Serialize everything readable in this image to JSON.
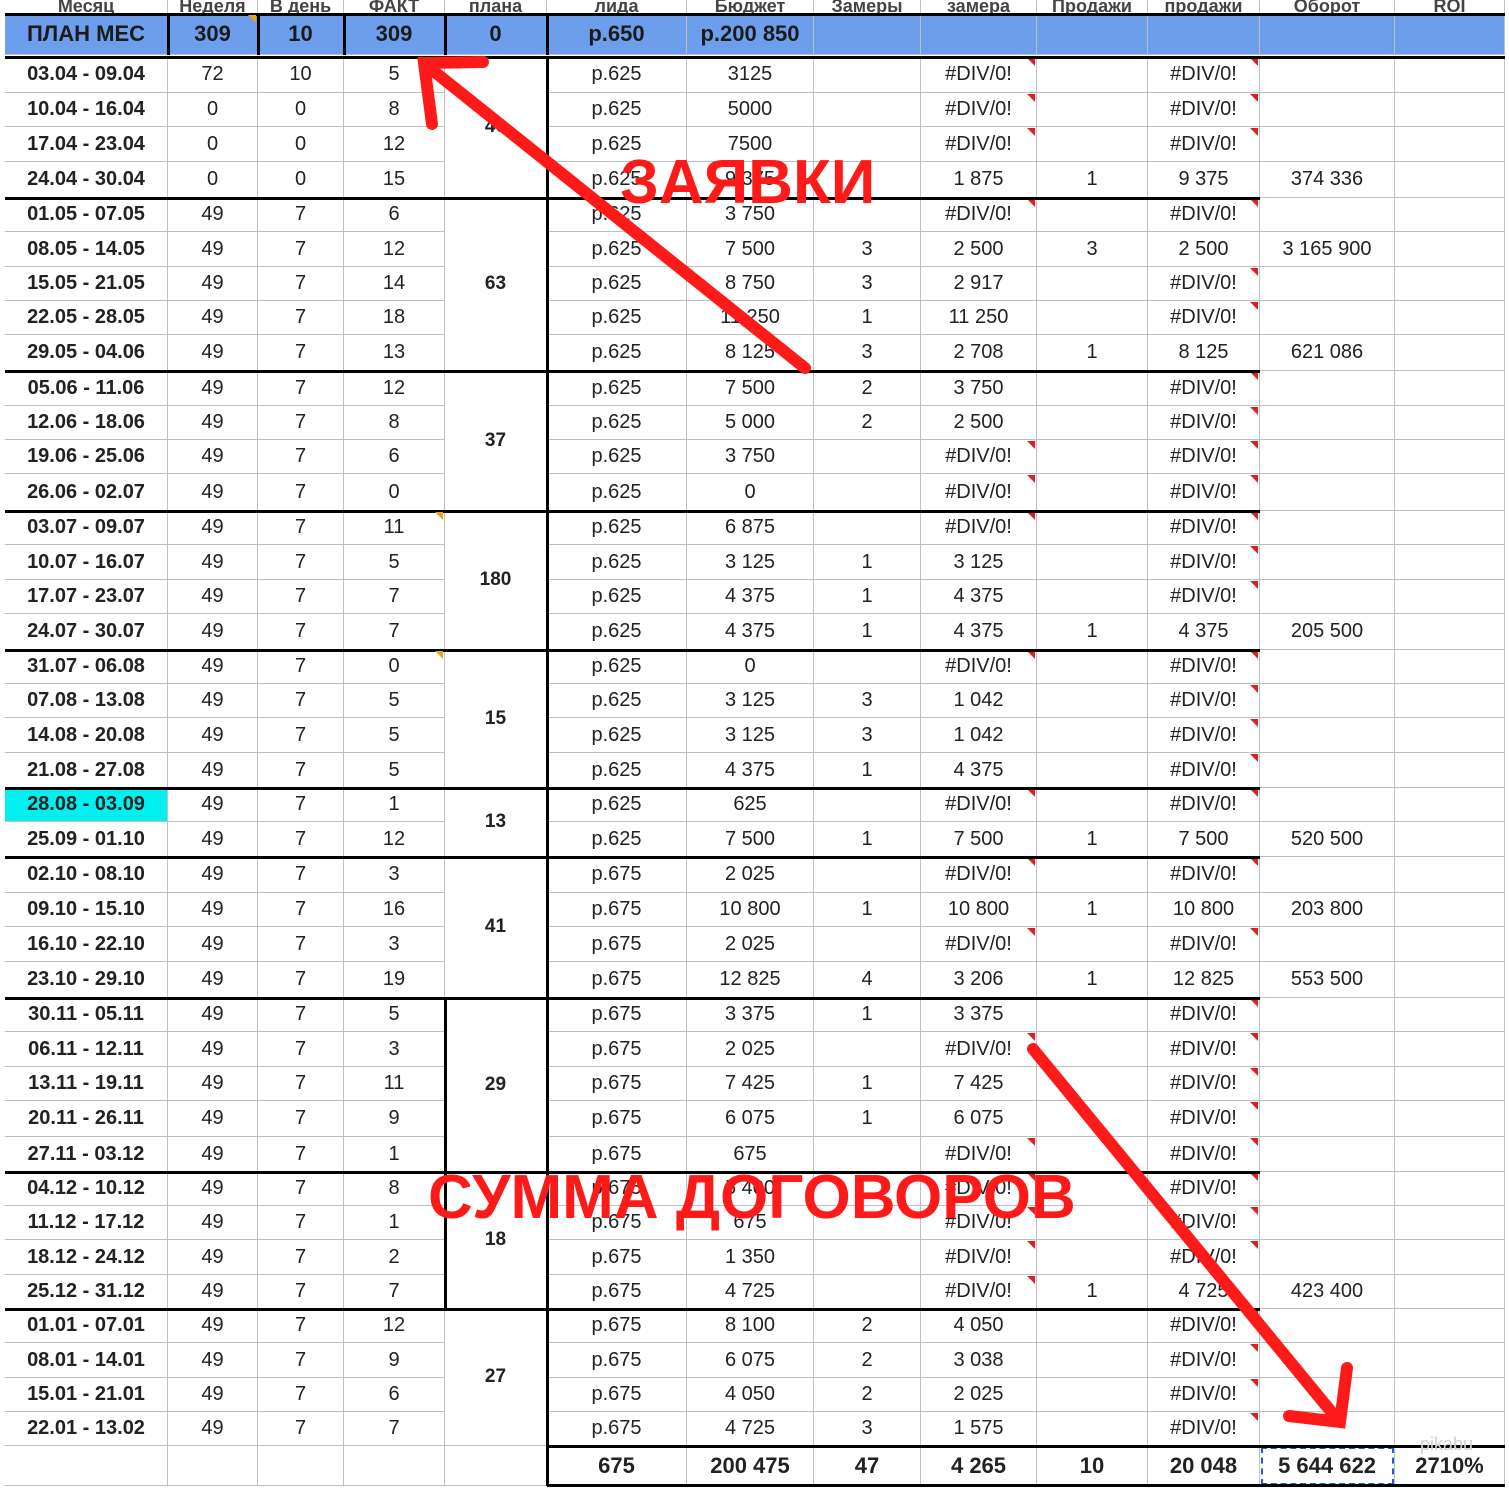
{
  "header_titles": [
    "Месяц",
    "Неделя",
    "В день",
    "ФАКТ",
    "плана",
    "лида",
    "Бюджет",
    "Замеры",
    "замера",
    "Продажи",
    "продажи",
    "Оборот",
    "ROI"
  ],
  "plan_row": [
    "ПЛАН МЕС",
    "309",
    "10",
    "309",
    "0",
    "р.650",
    "р.200 850",
    "",
    "",
    "",
    "",
    "",
    ""
  ],
  "weeks": [
    [
      "03.04 - 09.04",
      "72",
      "10",
      "5",
      "р.625",
      "3125",
      "",
      "#DIV/0!",
      "",
      "#DIV/0!",
      "",
      ""
    ],
    [
      "10.04 - 16.04",
      "0",
      "0",
      "8",
      "р.625",
      "5000",
      "",
      "#DIV/0!",
      "",
      "#DIV/0!",
      "",
      ""
    ],
    [
      "17.04 - 23.04",
      "0",
      "0",
      "12",
      "р.625",
      "7500",
      "",
      "#DIV/0!",
      "",
      "#DIV/0!",
      "",
      ""
    ],
    [
      "24.04 - 30.04",
      "0",
      "0",
      "15",
      "р.625",
      "9 375",
      "",
      "1 875",
      "1",
      "9 375",
      "374 336",
      ""
    ],
    [
      "01.05 - 07.05",
      "49",
      "7",
      "6",
      "р.625",
      "3 750",
      "",
      "#DIV/0!",
      "",
      "#DIV/0!",
      "",
      ""
    ],
    [
      "08.05 - 14.05",
      "49",
      "7",
      "12",
      "р.625",
      "7 500",
      "3",
      "2 500",
      "3",
      "2 500",
      "3 165 900",
      ""
    ],
    [
      "15.05 - 21.05",
      "49",
      "7",
      "14",
      "р.625",
      "8 750",
      "3",
      "2 917",
      "",
      "#DIV/0!",
      "",
      ""
    ],
    [
      "22.05 - 28.05",
      "49",
      "7",
      "18",
      "р.625",
      "11 250",
      "1",
      "11 250",
      "",
      "#DIV/0!",
      "",
      ""
    ],
    [
      "29.05 - 04.06",
      "49",
      "7",
      "13",
      "р.625",
      "8 125",
      "3",
      "2 708",
      "1",
      "8 125",
      "621 086",
      ""
    ],
    [
      "05.06 - 11.06",
      "49",
      "7",
      "12",
      "р.625",
      "7 500",
      "2",
      "3 750",
      "",
      "#DIV/0!",
      "",
      ""
    ],
    [
      "12.06 - 18.06",
      "49",
      "7",
      "8",
      "р.625",
      "5 000",
      "2",
      "2 500",
      "",
      "#DIV/0!",
      "",
      ""
    ],
    [
      "19.06 - 25.06",
      "49",
      "7",
      "6",
      "р.625",
      "3 750",
      "",
      "#DIV/0!",
      "",
      "#DIV/0!",
      "",
      ""
    ],
    [
      "26.06 - 02.07",
      "49",
      "7",
      "0",
      "р.625",
      "0",
      "",
      "#DIV/0!",
      "",
      "#DIV/0!",
      "",
      ""
    ],
    [
      "03.07 - 09.07",
      "49",
      "7",
      "11",
      "р.625",
      "6 875",
      "",
      "#DIV/0!",
      "",
      "#DIV/0!",
      "",
      ""
    ],
    [
      "10.07  - 16.07",
      "49",
      "7",
      "5",
      "р.625",
      "3 125",
      "1",
      "3 125",
      "",
      "#DIV/0!",
      "",
      ""
    ],
    [
      "17.07 - 23.07",
      "49",
      "7",
      "7",
      "р.625",
      "4 375",
      "1",
      "4 375",
      "",
      "#DIV/0!",
      "",
      ""
    ],
    [
      "24.07 - 30.07",
      "49",
      "7",
      "7",
      "р.625",
      "4 375",
      "1",
      "4 375",
      "1",
      "4 375",
      "205 500",
      ""
    ],
    [
      "31.07 - 06.08",
      "49",
      "7",
      "0",
      "р.625",
      "0",
      "",
      "#DIV/0!",
      "",
      "#DIV/0!",
      "",
      ""
    ],
    [
      "07.08 - 13.08",
      "49",
      "7",
      "5",
      "р.625",
      "3 125",
      "3",
      "1 042",
      "",
      "#DIV/0!",
      "",
      ""
    ],
    [
      "14.08 - 20.08",
      "49",
      "7",
      "5",
      "р.625",
      "3 125",
      "3",
      "1 042",
      "",
      "#DIV/0!",
      "",
      ""
    ],
    [
      "21.08 - 27.08",
      "49",
      "7",
      "5",
      "р.625",
      "4 375",
      "1",
      "4 375",
      "",
      "#DIV/0!",
      "",
      ""
    ],
    [
      "28.08 - 03.09",
      "49",
      "7",
      "1",
      "р.625",
      "625",
      "",
      "#DIV/0!",
      "",
      "#DIV/0!",
      "",
      ""
    ],
    [
      "25.09 - 01.10",
      "49",
      "7",
      "12",
      "р.625",
      "7 500",
      "1",
      "7 500",
      "1",
      "7 500",
      "520 500",
      ""
    ],
    [
      "02.10 - 08.10",
      "49",
      "7",
      "3",
      "р.675",
      "2 025",
      "",
      "#DIV/0!",
      "",
      "#DIV/0!",
      "",
      ""
    ],
    [
      "09.10 - 15.10",
      "49",
      "7",
      "16",
      "р.675",
      "10 800",
      "1",
      "10 800",
      "1",
      "10 800",
      "203 800",
      ""
    ],
    [
      "16.10 - 22.10",
      "49",
      "7",
      "3",
      "р.675",
      "2 025",
      "",
      "#DIV/0!",
      "",
      "#DIV/0!",
      "",
      ""
    ],
    [
      "23.10 - 29.10",
      "49",
      "7",
      "19",
      "р.675",
      "12 825",
      "4",
      "3 206",
      "1",
      "12 825",
      "553 500",
      ""
    ],
    [
      "30.11 - 05.11",
      "49",
      "7",
      "5",
      "р.675",
      "3 375",
      "1",
      "3 375",
      "",
      "#DIV/0!",
      "",
      ""
    ],
    [
      "06.11 - 12.11",
      "49",
      "7",
      "3",
      "р.675",
      "2 025",
      "",
      "#DIV/0!",
      "",
      "#DIV/0!",
      "",
      ""
    ],
    [
      "13.11 - 19.11",
      "49",
      "7",
      "11",
      "р.675",
      "7 425",
      "1",
      "7 425",
      "",
      "#DIV/0!",
      "",
      ""
    ],
    [
      "20.11 - 26.11",
      "49",
      "7",
      "9",
      "р.675",
      "6 075",
      "1",
      "6 075",
      "",
      "#DIV/0!",
      "",
      ""
    ],
    [
      "27.11 - 03.12",
      "49",
      "7",
      "1",
      "р.675",
      "675",
      "",
      "#DIV/0!",
      "",
      "#DIV/0!",
      "",
      ""
    ],
    [
      "04.12 - 10.12",
      "49",
      "7",
      "8",
      "р.675",
      "5 400",
      "",
      "#DIV/0!",
      "",
      "#DIV/0!",
      "",
      ""
    ],
    [
      "11.12 - 17.12",
      "49",
      "7",
      "1",
      "р.675",
      "675",
      "",
      "#DIV/0!",
      "",
      "#DIV/0!",
      "",
      ""
    ],
    [
      "18.12 - 24.12",
      "49",
      "7",
      "2",
      "р.675",
      "1 350",
      "",
      "#DIV/0!",
      "",
      "#DIV/0!",
      "",
      ""
    ],
    [
      "25.12 - 31.12",
      "49",
      "7",
      "7",
      "р.675",
      "4 725",
      "",
      "#DIV/0!",
      "1",
      "4 725",
      "423 400",
      ""
    ],
    [
      "01.01 - 07.01",
      "49",
      "7",
      "12",
      "р.675",
      "8 100",
      "2",
      "4 050",
      "",
      "#DIV/0!",
      "",
      ""
    ],
    [
      "08.01 - 14.01",
      "49",
      "7",
      "9",
      "р.675",
      "6 075",
      "2",
      "3 038",
      "",
      "#DIV/0!",
      "",
      ""
    ],
    [
      "15.01 - 21.01",
      "49",
      "7",
      "6",
      "р.675",
      "4 050",
      "2",
      "2 025",
      "",
      "#DIV/0!",
      "",
      ""
    ],
    [
      "22.01 - 13.02",
      "49",
      "7",
      "7",
      "р.675",
      "4 725",
      "3",
      "1 575",
      "",
      "#DIV/0!",
      "",
      ""
    ]
  ],
  "highlighted_week": "28.08 - 03.09",
  "month_groups": [
    {
      "label": "40",
      "start": 0,
      "count": 4
    },
    {
      "label": "63",
      "start": 4,
      "count": 5
    },
    {
      "label": "37",
      "start": 9,
      "count": 4
    },
    {
      "label": "180",
      "start": 13,
      "count": 4
    },
    {
      "label": "15",
      "start": 17,
      "count": 4
    },
    {
      "label": "13",
      "start": 21,
      "count": 2
    },
    {
      "label": "41",
      "start": 23,
      "count": 4
    },
    {
      "label": "29",
      "start": 27,
      "count": 5
    },
    {
      "label": "18",
      "start": 32,
      "count": 4
    },
    {
      "label": "27",
      "start": 36,
      "count": 4
    }
  ],
  "totals_row": [
    "",
    "",
    "",
    "",
    "",
    "675",
    "200 475",
    "47",
    "4 265",
    "10",
    "20 048",
    "5 644 622",
    "2710%"
  ],
  "annotations": {
    "top_label": "ЗАЯВКИ",
    "bottom_label": "СУММА ДОГОВОРОВ",
    "color": "#ff1a1a"
  },
  "colors": {
    "header_bg": "#6d9eeb",
    "highlight_bg": "#00f0f0",
    "comment_marker": "#e02020",
    "note_marker": "#f0a020"
  }
}
